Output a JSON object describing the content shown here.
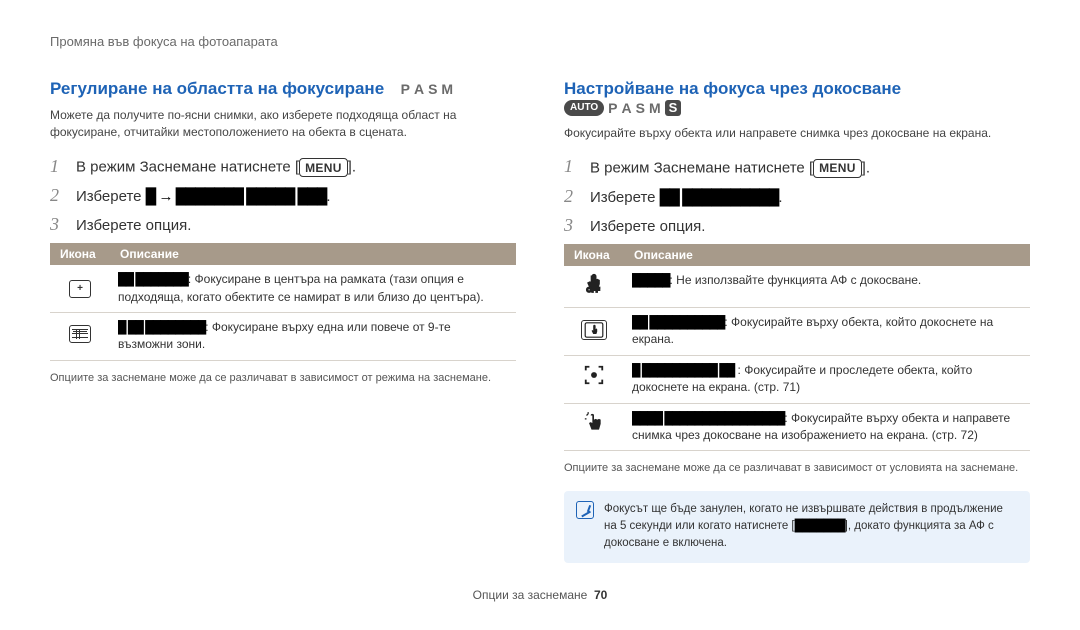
{
  "page_header": "Промяна във фокуса на фотоапарата",
  "left": {
    "title": "Регулиране на областта на фокусиране",
    "modes": [
      "P",
      "A",
      "S",
      "M"
    ],
    "intro": "Можете да получите по-ясни снимки, ако изберете подходяща област на фокусиране, отчитайки местоположението на обекта в сцената.",
    "steps": {
      "1_a": "В режим Заснемане натиснете [",
      "1_b": "].",
      "2": "Изберете ",
      "2_blot": "█ → ███████ █████ ███",
      "2_end": ".",
      "3": "Изберете опция."
    },
    "table": {
      "hdr_icon": "Икона",
      "hdr_desc": "Описание",
      "rows": [
        {
          "label_blot": "██ ███████",
          "desc": ": Фокусиране в центъра на рамката (тази опция е подходяща, когато обектите се намират в или близо до центъра)."
        },
        {
          "label_blot": "█ ██ ████████",
          "desc": ": Фокусиране върху една или повече от 9-те възможни зони."
        }
      ]
    },
    "footnote": "Опциите за заснемане може да се различават в зависимост от режима на заснемане."
  },
  "right": {
    "title": "Настройване на фокуса чрез докосване",
    "modes_pre": "AUTO",
    "modes": [
      "P",
      "A",
      "S",
      "M"
    ],
    "modes_post": "S",
    "intro": "Фокусирайте върху обекта или направете снимка чрез докосване на екрана.",
    "steps": {
      "1_a": "В режим Заснемане натиснете [",
      "1_b": "].",
      "2": "Изберете ",
      "2_blot": "██ ██████████",
      "2_end": ".",
      "3": "Изберете опция."
    },
    "table": {
      "hdr_icon": "Икона",
      "hdr_desc": "Описание",
      "rows": [
        {
          "label_blot": "█████",
          "desc": ": Не използвайте функцията АФ с докосване."
        },
        {
          "label_blot": "██ ██████████",
          "desc": ": Фокусирайте върху обекта, който докоснете на екрана."
        },
        {
          "label_blot": "█ ██████████ ██",
          "desc": " : Фокусирайте и проследете обекта, който докоснете на екрана. (стр. 71)"
        },
        {
          "label_blot": "████ ████████████████",
          "desc": ": Фокусирайте върху обекта и направете снимка чрез докосване на изображението на екрана. (стр. 72)"
        }
      ]
    },
    "footnote": "Опциите за заснемане може да се различават в зависимост от условията на заснемане.",
    "note_a": "Фокусът ще бъде занулен, когато не извършвате действия в продължение на 5 секунди или когато натиснете [",
    "note_blot": "███████",
    "note_b": "], докато функцията за АФ с докосване е включена."
  },
  "footer": {
    "label": "Опции за заснемане",
    "page": "70"
  },
  "menu_label": "MENU"
}
